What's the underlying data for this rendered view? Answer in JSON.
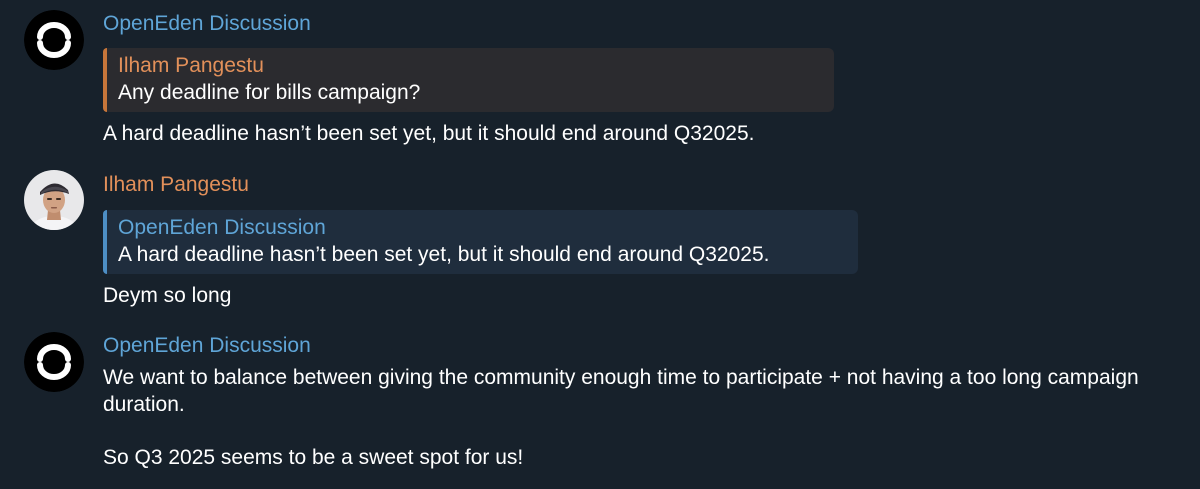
{
  "messages": [
    {
      "sender": "OpenEden Discussion",
      "avatar_icon": "openeden-logo-icon",
      "reply": {
        "sender": "Ilham Pangestu",
        "text": "Any deadline for bills campaign?"
      },
      "text": "A hard deadline hasn’t been set yet, but it should end around Q32025."
    },
    {
      "sender": "Ilham Pangestu",
      "avatar_icon": "user-photo-avatar",
      "reply": {
        "sender": "OpenEden Discussion",
        "text": "A hard deadline hasn’t been set yet, but it should end around Q32025."
      },
      "text": "Deym so long"
    },
    {
      "sender": "OpenEden Discussion",
      "avatar_icon": "openeden-logo-icon",
      "text_line_1": "We want to balance between giving the community enough time to participate + not having a too long campaign duration.",
      "text_line_2": "So Q3 2025 seems to be a sweet spot for us!"
    }
  ],
  "colors": {
    "background": "#17212b",
    "sender_blue": "#5fa5d7",
    "sender_orange": "#e2905a",
    "quote_orange_bar": "#c7763a",
    "quote_blue_bar": "#4d8ec4"
  }
}
